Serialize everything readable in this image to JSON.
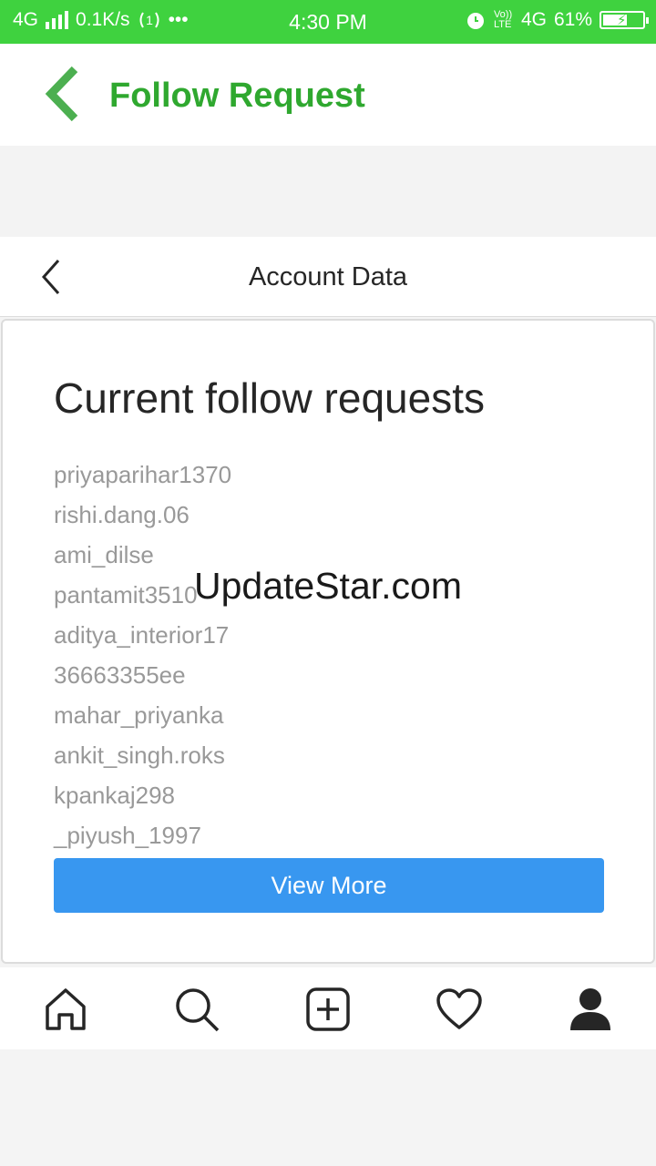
{
  "status_bar": {
    "network": "4G",
    "speed": "0.1K/s",
    "more": "•••",
    "time": "4:30 PM",
    "volte": "Vo)) LTE",
    "network2": "4G",
    "battery": "61%",
    "battery_level": 0.61
  },
  "app_header": {
    "title": "Follow Request"
  },
  "nav": {
    "title": "Account Data"
  },
  "card": {
    "heading": "Current follow requests",
    "requests": [
      "priyaparihar1370",
      "rishi.dang.06",
      "ami_dilse",
      "pantamit3510",
      "aditya_interior17",
      "36663355ee",
      "mahar_priyanka",
      "ankit_singh.roks",
      "kpankaj298",
      "_piyush_1997"
    ],
    "button": "View More"
  },
  "watermark": "UpdateStar.com",
  "tabs": [
    "home-icon",
    "search-icon",
    "add-post-icon",
    "heart-icon",
    "profile-icon"
  ],
  "colors": {
    "status_bar": "#3fd23f",
    "header_title": "#2fa82f",
    "button": "#3897f0"
  }
}
